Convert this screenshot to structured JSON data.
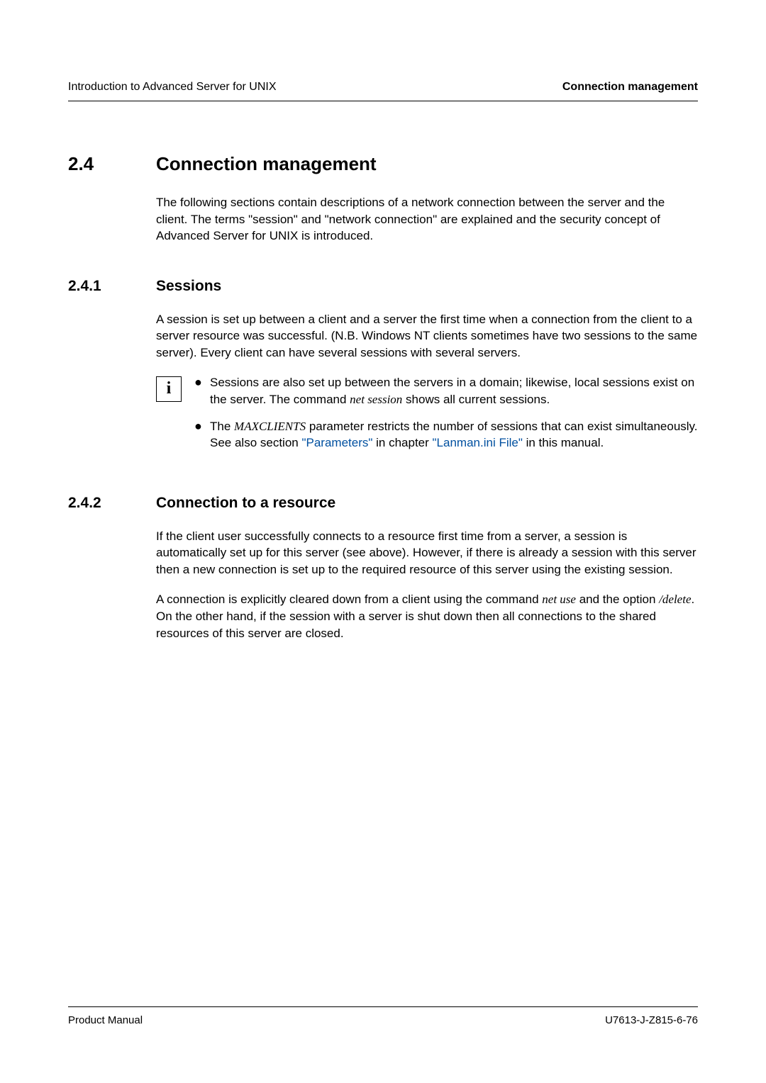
{
  "header": {
    "left": "Introduction to Advanced Server for UNIX",
    "right": "Connection management"
  },
  "section": {
    "number": "2.4",
    "title": "Connection management",
    "intro": "The following sections contain descriptions of a network connection between the server and the client. The terms \"session\" and \"network connection\" are explained and the security concept of Advanced Server for UNIX is introduced."
  },
  "sub1": {
    "number": "2.4.1",
    "title": "Sessions",
    "para": "A session is set up between a client and a server the first time when a connection from the client to a server resource was successful. (N.B. Windows NT clients sometimes have two sessions to the same server). Every client can have several sessions with several servers.",
    "bullets": {
      "b1_pre": "Sessions are also set up between the servers in a domain; likewise, local sessions exist on the server. The command ",
      "b1_cmd": "net session",
      "b1_post": " shows all current sessions.",
      "b2_pre": "The ",
      "b2_param": "MAXCLIENTS",
      "b2_mid": " parameter restricts the number of sessions that can exist simultaneously. See also section ",
      "b2_link1": "\"Parameters\"",
      "b2_mid2": " in chapter ",
      "b2_link2": "\"Lanman.ini File\"",
      "b2_post": " in this manual."
    }
  },
  "sub2": {
    "number": "2.4.2",
    "title": "Connection to a resource",
    "para1": "If the client user successfully connects to a resource first time from a server, a session is automatically set up for this server (see above). However, if there is already a session with this server then a new connection is set up to the required resource of this server using the existing session.",
    "para2_pre": "A connection is explicitly cleared down from a client using the command ",
    "para2_cmd1": "net use",
    "para2_mid": " and the option ",
    "para2_cmd2": "/delete",
    "para2_post": ". On the other hand, if the session with a server is shut down then all connections to the shared resources of this server are closed."
  },
  "footer": {
    "left": "Product Manual",
    "right": "U7613-J-Z815-6-76"
  }
}
